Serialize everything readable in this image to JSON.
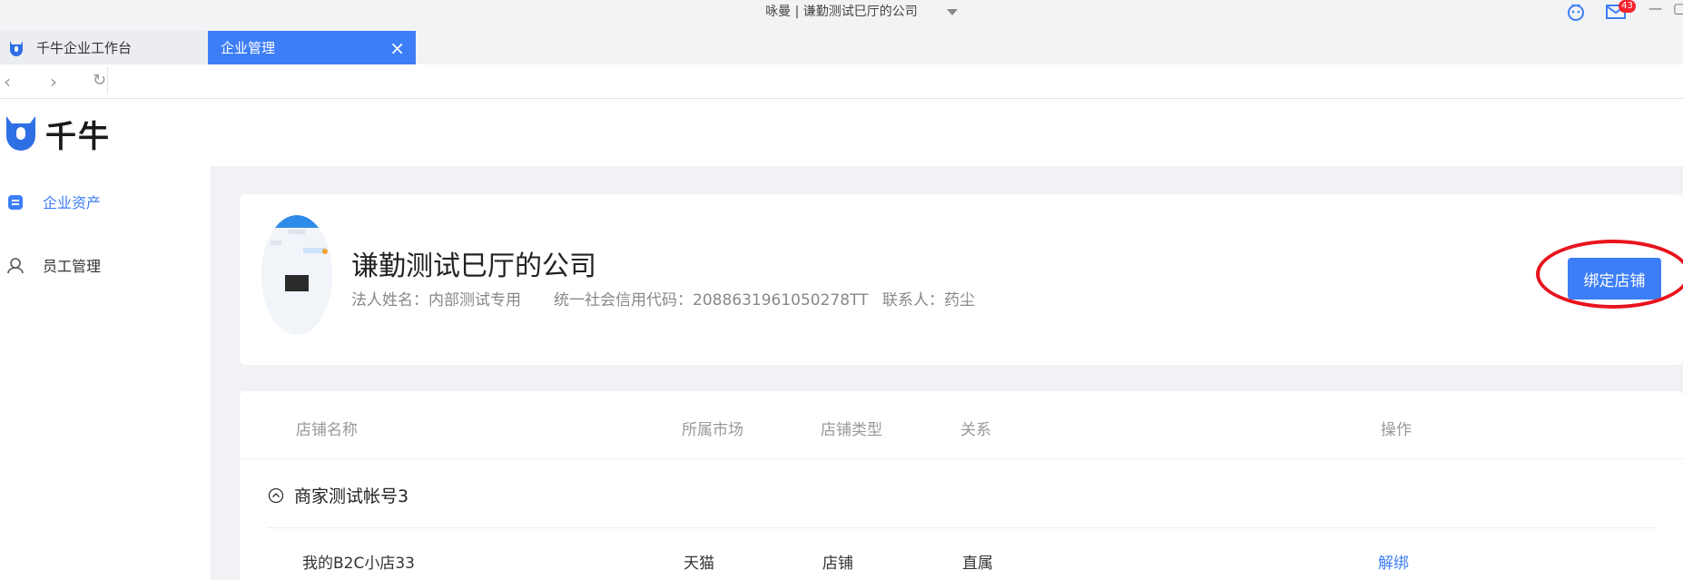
{
  "window": {
    "title": "咏曼 | 谦勤测试巳厅的公司",
    "mail_badge": "43"
  },
  "tabs": [
    {
      "label": "千牛企业工作台"
    },
    {
      "label": "企业管理",
      "close": "×"
    }
  ],
  "nav": {
    "back": "‹",
    "forward": "›",
    "refresh": "↻"
  },
  "app": {
    "logo_text": "千牛"
  },
  "sidebar": {
    "items": [
      {
        "label": "企业资产",
        "icon": "clipboard-icon",
        "active": true
      },
      {
        "label": "员工管理",
        "icon": "person-icon",
        "active": false
      }
    ]
  },
  "company": {
    "name": "谦勤测试巳厅的公司",
    "legal_person": "法人姓名：内部测试专用",
    "credit_code": "统一社会信用代码：2088631961050278TT",
    "contact": "联系人：药尘",
    "bind_button": "绑定店铺"
  },
  "table": {
    "headers": [
      "店铺名称",
      "所属市场",
      "店铺类型",
      "关系",
      "操作"
    ],
    "group": {
      "name": "商家测试帐号3",
      "expanded": true
    },
    "rows": [
      {
        "name": "我的B2C小店33",
        "market": "天猫",
        "type": "店铺",
        "relation": "直属",
        "action": "解绑"
      }
    ]
  },
  "colors": {
    "accent": "#3d7ef7",
    "highlight_ring": "#e8141d",
    "background": "#f0f2f5"
  }
}
